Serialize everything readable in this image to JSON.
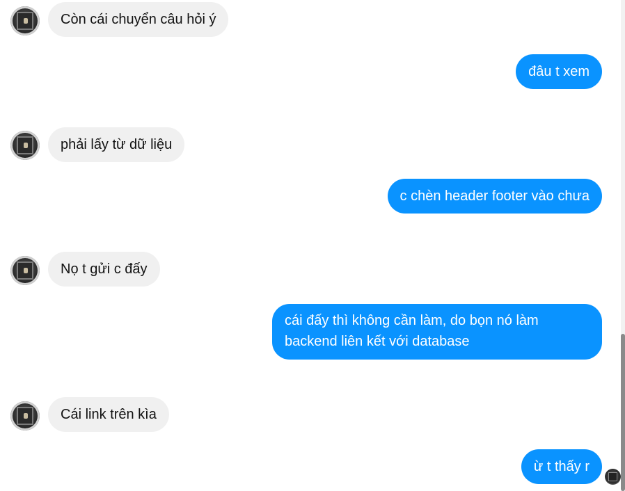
{
  "messages": [
    {
      "side": "in",
      "text": "Còn cái chuyển câu hỏi ý"
    },
    {
      "side": "out",
      "text": "đâu t xem"
    },
    {
      "side": "in",
      "text": "phải lấy từ dữ liệu"
    },
    {
      "side": "out",
      "text": "c chèn header footer vào chưa"
    },
    {
      "side": "in",
      "text": "Nọ t gửi c đấy"
    },
    {
      "side": "out",
      "text": "cái đấy thì không cần làm, do bọn nó làm backend liên kết với database"
    },
    {
      "side": "in",
      "text": "Cái link trên kìa"
    },
    {
      "side": "out",
      "text": "ừ t thấy r"
    }
  ],
  "colors": {
    "incoming_bubble": "#f0f0f0",
    "outgoing_bubble": "#0a93ff",
    "outgoing_text": "#ffffff",
    "incoming_text": "#111111"
  },
  "icons": {
    "contact_avatar": "avatar",
    "seen_indicator": "seen-avatar-icon"
  }
}
